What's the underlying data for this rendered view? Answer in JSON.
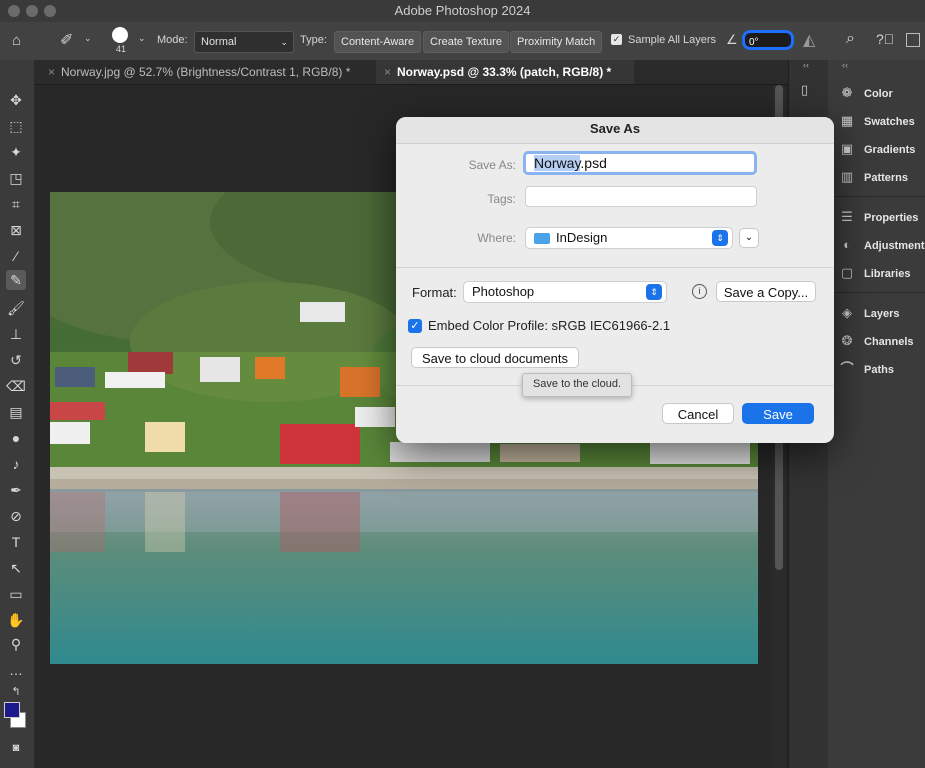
{
  "app": {
    "window_title": "Adobe Photoshop 2024"
  },
  "options_bar": {
    "brush_size": "41",
    "mode_label": "Mode:",
    "mode_value": "Normal",
    "type_label": "Type:",
    "type_options": [
      "Content-Aware",
      "Create Texture",
      "Proximity Match"
    ],
    "sample_all_layers": "Sample All Layers",
    "angle_value": "0°"
  },
  "tabs": [
    {
      "label": "Norway.jpg @ 52.7% (Brightness/Contrast 1, RGB/8) *",
      "active": false
    },
    {
      "label": "Norway.psd @ 33.3% (patch, RGB/8) *",
      "active": true
    }
  ],
  "panels": {
    "items": [
      "Color",
      "Swatches",
      "Gradients",
      "Patterns",
      "Properties",
      "Adjustments",
      "Libraries",
      "Layers",
      "Channels",
      "Paths"
    ]
  },
  "colors": {
    "foreground": "#1d1a8e",
    "background": "#ffffff",
    "accent": "#1a73e8"
  },
  "dialog": {
    "title": "Save As",
    "save_as_label": "Save As:",
    "filename_selected": "Norway",
    "filename_ext": ".psd",
    "tags_label": "Tags:",
    "where_label": "Where:",
    "where_value": "InDesign",
    "format_label": "Format:",
    "format_value": "Photoshop",
    "save_copy_button": "Save a Copy...",
    "embed_profile": "Embed Color Profile:  sRGB IEC61966-2.1",
    "cloud_button": "Save to cloud documents",
    "tooltip": "Save to the cloud.",
    "cancel_button": "Cancel",
    "save_button": "Save"
  }
}
